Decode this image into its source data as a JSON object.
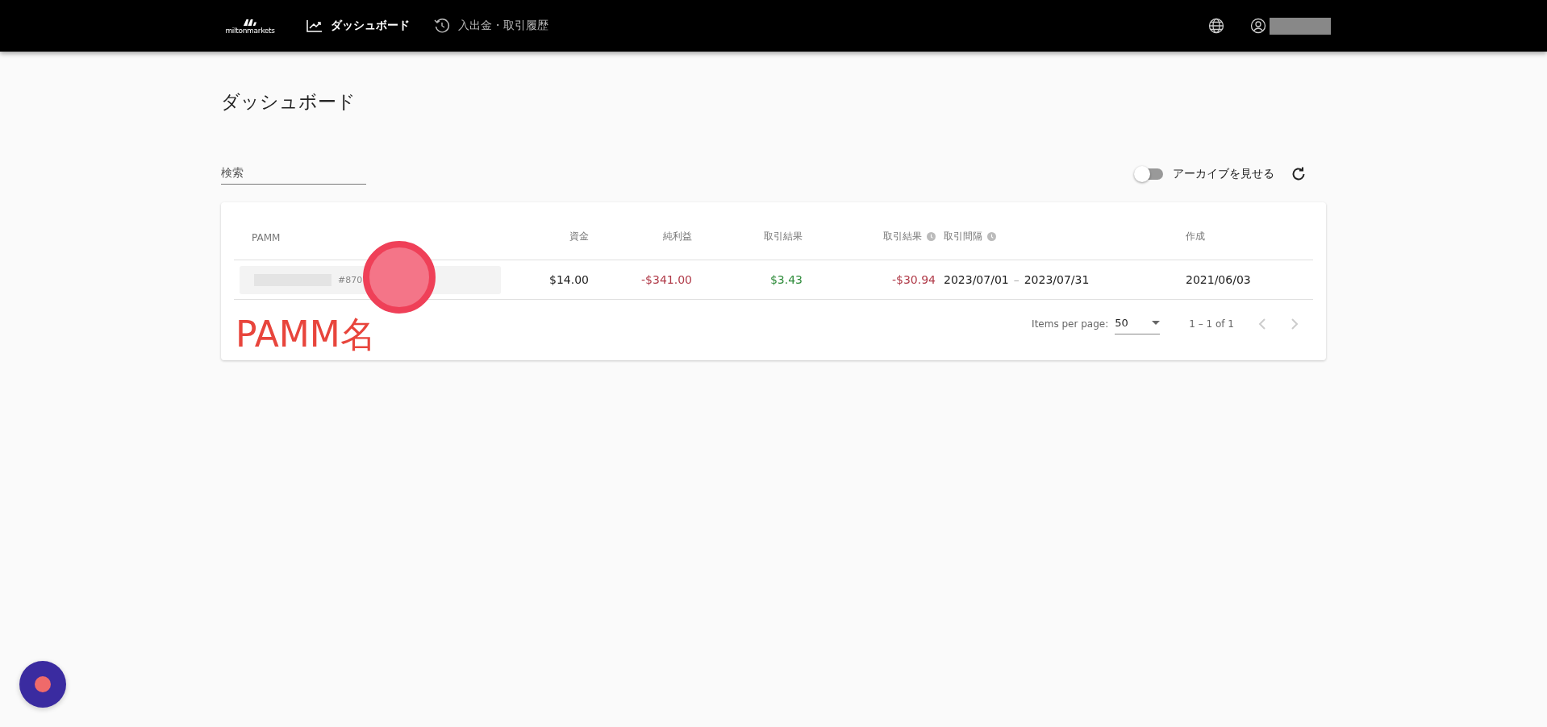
{
  "header": {
    "logo": "miltonmarkets",
    "nav": [
      {
        "label": "ダッシュボード",
        "selected": true
      },
      {
        "label": "入出金・取引履歴",
        "selected": false
      }
    ]
  },
  "page_title": "ダッシュボード",
  "search": {
    "placeholder": "検索"
  },
  "archive_toggle": {
    "label": "アーカイブを見せる",
    "on": false
  },
  "table": {
    "columns": [
      {
        "label": "PAMM",
        "info": false
      },
      {
        "label": "資金",
        "info": false
      },
      {
        "label": "純利益",
        "info": false
      },
      {
        "label": "取引結果",
        "info": false
      },
      {
        "label": "取引結果",
        "info": true
      },
      {
        "label": "取引間隔",
        "info": true
      },
      {
        "label": "作成",
        "info": false
      }
    ],
    "rows": [
      {
        "pamm_id": "#870",
        "funds": "$14.00",
        "net_profit": {
          "text": "-$341.00",
          "color": "#b03a48"
        },
        "result": {
          "text": "$3.43",
          "color": "#2e8b3a"
        },
        "result_2": {
          "text": "-$30.94",
          "color": "#b03a48"
        },
        "period_start": "2023/07/01",
        "period_sep": "–",
        "period_end": "2023/07/31",
        "created": "2021/06/03"
      }
    ]
  },
  "paginator": {
    "items_label": "Items per page:",
    "page_size": "50",
    "range": "1 – 1 of 1"
  },
  "annotation": "PAMM名"
}
